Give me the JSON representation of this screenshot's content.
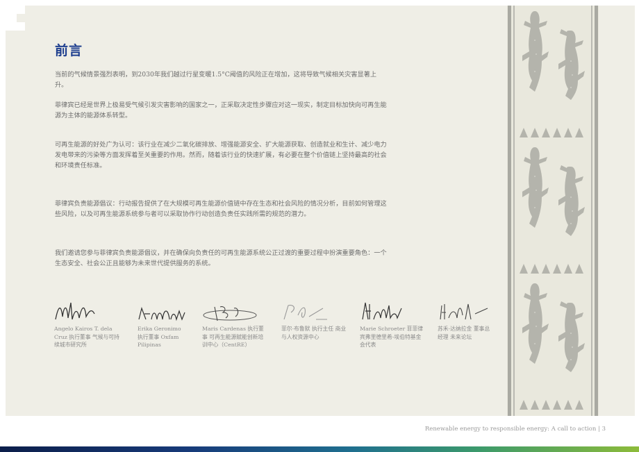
{
  "page": {
    "title": "前言",
    "paragraphs": [
      "当前的气候情景强烈表明，到2030年我们越过行星变暖1.5°C阈值的风险正在增加，这将导致气候相关灾害显著上升。",
      "菲律宾已经是世界上极易受气候引发灾害影响的国家之一，正采取决定性步骤应对这一现实，制定目标加快向可再生能源为主体的能源体系转型。",
      "可再生能源的好处广为认可：该行业在减少二氧化碳排放、增强能源安全、扩大能源获取、创造就业和生计、减少电力发电带来的污染等方面发挥着至关重要的作用。然而，随着该行业的快速扩展，有必要在整个价值链上坚持最高的社会和环境责任标准。",
      "菲律宾负责能源倡议：行动报告提供了在大规模可再生能源价值链中存在生态和社会风险的情况分析，目前如何管理这些风险，以及可再生能源系统参与者可以采取协作行动创造负责任实践所需的规范的潜力。",
      "我们邀请您参与菲律宾负责能源倡议，并在确保向负责任的可再生能源系统公正过渡的重要过程中扮演重要角色：一个生态安全、社会公正且能够为未来世代提供服务的系统。"
    ],
    "signatories": [
      {
        "caption": "Angelo Kairos T. dela Cruz 执行董事 气候与可持续城市研究所"
      },
      {
        "caption": "Erika Geronimo 执行董事 Oxfam Pilipinas"
      },
      {
        "caption": "Maris Cardenas 执行董事 可再生能源赋能创新培训中心（CentRE）"
      },
      {
        "caption": "菲尔·布鲁默 执行主任 商业与人权资源中心"
      },
      {
        "caption": "Marie Schroeter 菲菲律宾弗里德里希-埃伯特基金会代表"
      },
      {
        "caption": "苏禾·达纳拉金 董事总经理 未来论坛"
      }
    ],
    "signature_marks": [
      "adtalaly",
      "Erika Montero"
    ],
    "footer": "Renewable energy to responsible energy: A call to action | 3"
  }
}
